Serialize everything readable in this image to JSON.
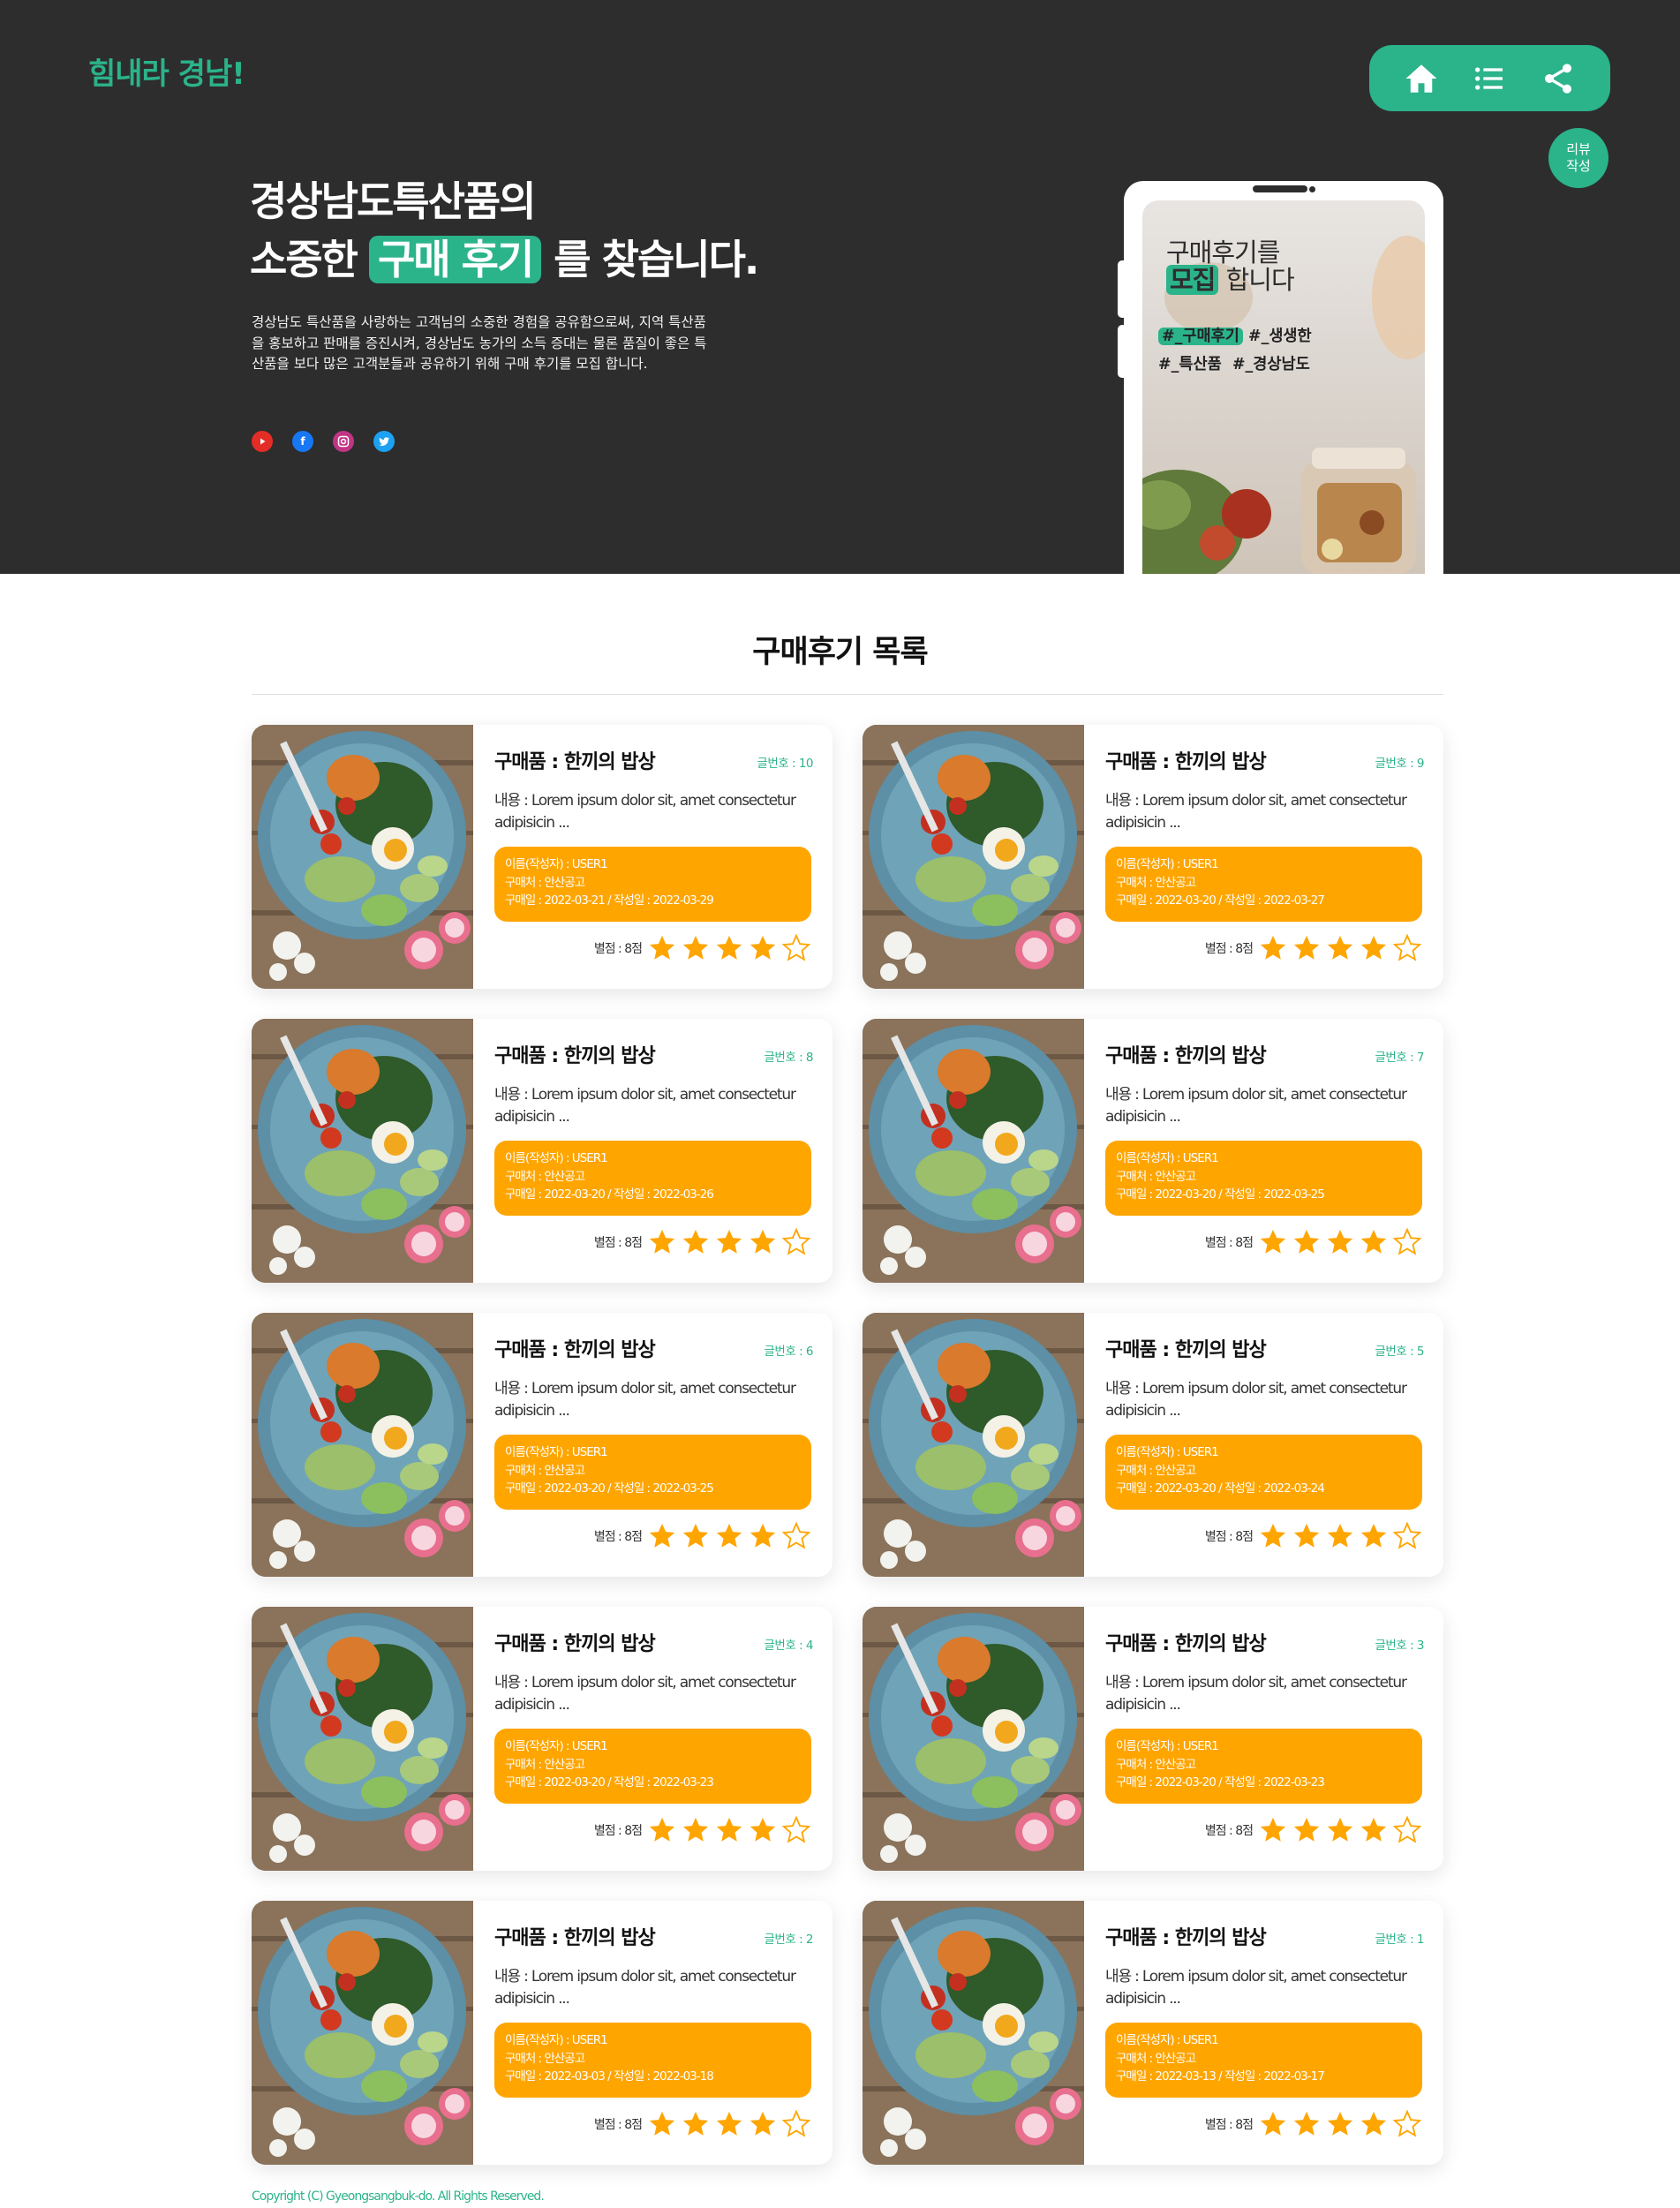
{
  "header": {
    "logo": "힘내라 경남!",
    "nav": [
      "home-icon",
      "list-icon",
      "share-icon"
    ],
    "review_button": "리뷰\n작성"
  },
  "hero": {
    "title_line1": "경상남도특산품의",
    "title_line2_a": "소중한",
    "title_line2_highlight": "구매 후기",
    "title_line2_b": "를 찾습니다.",
    "description": "경상남도 특산품을 사랑하는 고객님의 소중한 경험을 공유함으로써, 지역 특산품을 홍보하고 판매를 증진시켜, 경상남도 농가의 소득 증대는 물론 품질이 좋은 특산품을 보다 많은 고객분들과 공유하기 위해 구매 후기를 모집 합니다.",
    "socials": [
      "youtube-icon",
      "facebook-icon",
      "instagram-icon",
      "twitter-icon"
    ]
  },
  "phone": {
    "line1": "구매후기를",
    "line2_highlight": "모집",
    "line2_rest": "합니다",
    "tag1_highlight": "#_구매후기",
    "tag1_rest": "#_생생한",
    "tag2": "#_특산품  #_경상남도"
  },
  "section": {
    "title": "구매후기 목록"
  },
  "reviews": [
    {
      "product": "구매품 : 한끼의 밥상",
      "number": "글번호 : 10",
      "content": "내용 : Lorem ipsum dolor sit, amet consectetur adipisicin ...",
      "name": "이름(작성자) : USER1",
      "place": "구매처 : 안산공고",
      "dates": "구매일 : 2022-03-21 / 작성일 : 2022-03-29",
      "rating_text": "별점 : 8점",
      "rating": 4
    },
    {
      "product": "구매품 : 한끼의 밥상",
      "number": "글번호 : 9",
      "content": "내용 : Lorem ipsum dolor sit, amet consectetur adipisicin ...",
      "name": "이름(작성자) : USER1",
      "place": "구매처 : 안산공고",
      "dates": "구매일 : 2022-03-20 / 작성일 : 2022-03-27",
      "rating_text": "별점 : 8점",
      "rating": 4
    },
    {
      "product": "구매품 : 한끼의 밥상",
      "number": "글번호 : 8",
      "content": "내용 : Lorem ipsum dolor sit, amet consectetur adipisicin ...",
      "name": "이름(작성자) : USER1",
      "place": "구매처 : 안산공고",
      "dates": "구매일 : 2022-03-20 / 작성일 : 2022-03-26",
      "rating_text": "별점 : 8점",
      "rating": 4
    },
    {
      "product": "구매품 : 한끼의 밥상",
      "number": "글번호 : 7",
      "content": "내용 : Lorem ipsum dolor sit, amet consectetur adipisicin ...",
      "name": "이름(작성자) : USER1",
      "place": "구매처 : 안산공고",
      "dates": "구매일 : 2022-03-20 / 작성일 : 2022-03-25",
      "rating_text": "별점 : 8점",
      "rating": 4
    },
    {
      "product": "구매품 : 한끼의 밥상",
      "number": "글번호 : 6",
      "content": "내용 : Lorem ipsum dolor sit, amet consectetur adipisicin ...",
      "name": "이름(작성자) : USER1",
      "place": "구매처 : 안산공고",
      "dates": "구매일 : 2022-03-20 / 작성일 : 2022-03-25",
      "rating_text": "별점 : 8점",
      "rating": 4
    },
    {
      "product": "구매품 : 한끼의 밥상",
      "number": "글번호 : 5",
      "content": "내용 : Lorem ipsum dolor sit, amet consectetur adipisicin ...",
      "name": "이름(작성자) : USER1",
      "place": "구매처 : 안산공고",
      "dates": "구매일 : 2022-03-20 / 작성일 : 2022-03-24",
      "rating_text": "별점 : 8점",
      "rating": 4
    },
    {
      "product": "구매품 : 한끼의 밥상",
      "number": "글번호 : 4",
      "content": "내용 : Lorem ipsum dolor sit, amet consectetur adipisicin ...",
      "name": "이름(작성자) : USER1",
      "place": "구매처 : 안산공고",
      "dates": "구매일 : 2022-03-20 / 작성일 : 2022-03-23",
      "rating_text": "별점 : 8점",
      "rating": 4
    },
    {
      "product": "구매품 : 한끼의 밥상",
      "number": "글번호 : 3",
      "content": "내용 : Lorem ipsum dolor sit, amet consectetur adipisicin ...",
      "name": "이름(작성자) : USER1",
      "place": "구매처 : 안산공고",
      "dates": "구매일 : 2022-03-20 / 작성일 : 2022-03-23",
      "rating_text": "별점 : 8점",
      "rating": 4
    },
    {
      "product": "구매품 : 한끼의 밥상",
      "number": "글번호 : 2",
      "content": "내용 : Lorem ipsum dolor sit, amet consectetur adipisicin ...",
      "name": "이름(작성자) : USER1",
      "place": "구매처 : 안산공고",
      "dates": "구매일 : 2022-03-03 / 작성일 : 2022-03-18",
      "rating_text": "별점 : 8점",
      "rating": 4
    },
    {
      "product": "구매품 : 한끼의 밥상",
      "number": "글번호 : 1",
      "content": "내용 : Lorem ipsum dolor sit, amet consectetur adipisicin ...",
      "name": "이름(작성자) : USER1",
      "place": "구매처 : 안산공고",
      "dates": "구매일 : 2022-03-13 / 작성일 : 2022-03-17",
      "rating_text": "별점 : 8점",
      "rating": 4
    }
  ],
  "footer": {
    "copyright": "Copyright (C) Gyeongsangbuk-do. All Rights Reserved."
  },
  "colors": {
    "brand_green": "#2bb38a",
    "hero_bg": "#2d2d2d",
    "info_orange": "#ffa500",
    "star_orange": "#ffa500"
  }
}
